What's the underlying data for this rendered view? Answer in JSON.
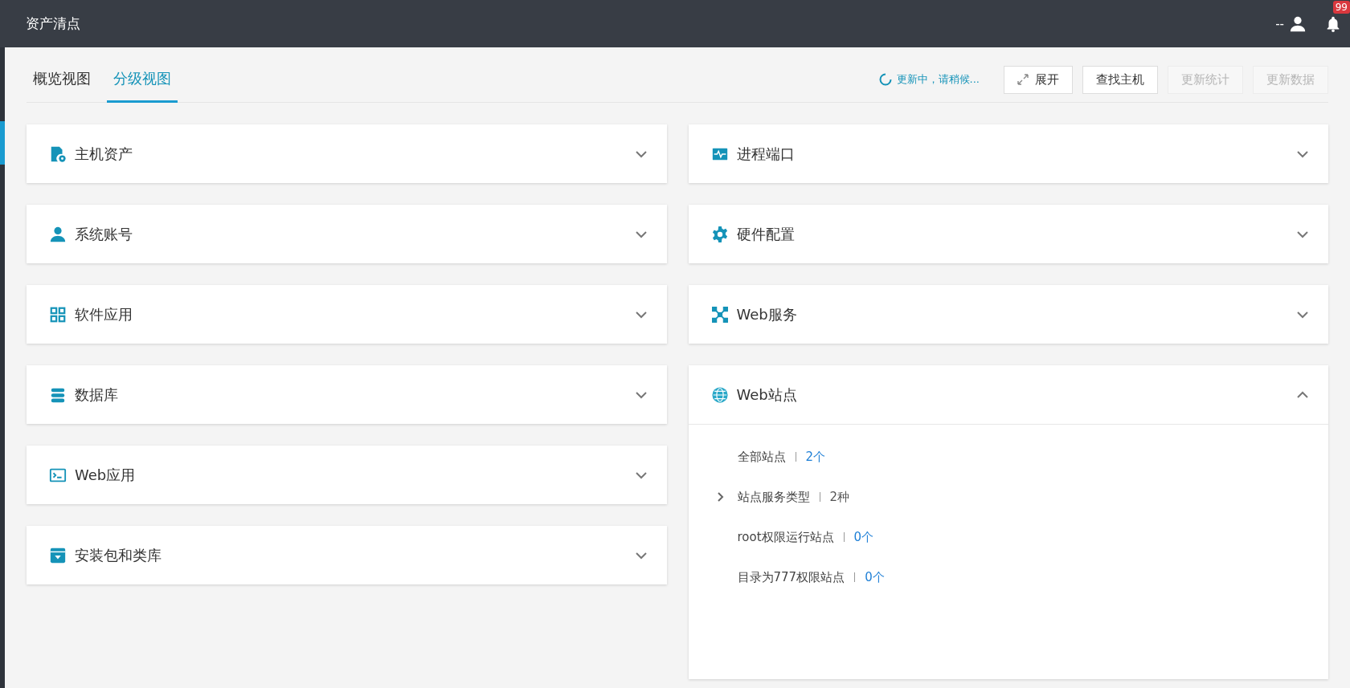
{
  "header": {
    "title": "资产清点",
    "user": "--",
    "notification_badge": "99"
  },
  "tabs": [
    {
      "label": "概览视图",
      "selected": false
    },
    {
      "label": "分级视图",
      "selected": true
    }
  ],
  "status": {
    "text": "更新中，请稍候..."
  },
  "buttons": [
    {
      "label": "展开",
      "kind": "expand",
      "disabled": false
    },
    {
      "label": "查找主机",
      "kind": "plain",
      "disabled": false
    },
    {
      "label": "更新统计",
      "kind": "plain",
      "disabled": true
    },
    {
      "label": "更新数据",
      "kind": "plain",
      "disabled": true
    }
  ],
  "columns": [
    {
      "sections": [
        {
          "title": "主机资产",
          "kind": "host",
          "expanded": false
        },
        {
          "title": "系统账号",
          "kind": "account",
          "expanded": false
        },
        {
          "title": "软件应用",
          "kind": "apps",
          "expanded": false
        },
        {
          "title": "数据库",
          "kind": "database",
          "expanded": false
        },
        {
          "title": "Web应用",
          "kind": "webapp",
          "expanded": false
        },
        {
          "title": "安装包和类库",
          "kind": "package",
          "expanded": false
        }
      ]
    },
    {
      "sections": [
        {
          "title": "进程端口",
          "kind": "process",
          "expanded": false
        },
        {
          "title": "硬件配置",
          "kind": "hardware",
          "expanded": false
        },
        {
          "title": "Web服务",
          "kind": "webservice",
          "expanded": false
        },
        {
          "title": "Web站点",
          "kind": "website",
          "expanded": true,
          "items": [
            {
              "label": "全部站点",
              "value": "2个",
              "link": true,
              "expandable": false
            },
            {
              "label": "站点服务类型",
              "value": "2种",
              "link": false,
              "expandable": true
            },
            {
              "label": "root权限运行站点",
              "value": "0个",
              "link": true,
              "expandable": false
            },
            {
              "label": "目录为777权限站点",
              "value": "0个",
              "link": true,
              "expandable": false
            }
          ]
        }
      ]
    }
  ]
}
